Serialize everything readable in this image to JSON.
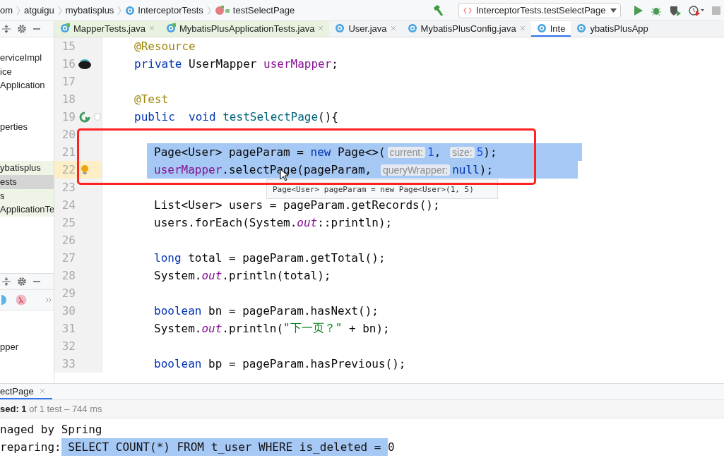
{
  "breadcrumbs": [
    {
      "label": "om",
      "kind": "package"
    },
    {
      "label": "atguigu",
      "kind": "package"
    },
    {
      "label": "mybatisplus",
      "kind": "package"
    },
    {
      "label": "InterceptorTests",
      "kind": "class"
    },
    {
      "label": "testSelectPage",
      "kind": "method"
    }
  ],
  "run_config": {
    "label": "InterceptorTests.testSelectPage"
  },
  "editor_tabs": [
    {
      "label": "MapperTests.java",
      "kind": "test",
      "selected": false
    },
    {
      "label": "MybatisPlusApplicationTests.java",
      "kind": "test",
      "selected": false
    },
    {
      "label": "User.java",
      "kind": "source",
      "selected": false
    },
    {
      "label": "MybatisPlusConfig.java",
      "kind": "source",
      "selected": false
    },
    {
      "label": "Inte",
      "kind": "source",
      "selected": true
    },
    {
      "label": "ybatisPlusApp",
      "kind": "source",
      "selected": false
    }
  ],
  "project_tree": [
    {
      "label": "erviceImpl",
      "kind": "source",
      "selected": false
    },
    {
      "label": "ice",
      "kind": "source",
      "selected": false
    },
    {
      "label": "Application",
      "kind": "source",
      "selected": false
    },
    {
      "label": "perties",
      "kind": "source",
      "selected": false
    },
    {
      "label": "ybatisplus",
      "kind": "test",
      "selected": false
    },
    {
      "label": "ests",
      "kind": "test",
      "selected": true
    },
    {
      "label": "s",
      "kind": "test",
      "selected": false
    },
    {
      "label": "ApplicationTe",
      "kind": "test",
      "selected": false
    }
  ],
  "structure_panel": {
    "items": [
      {
        "label": "pper"
      }
    ]
  },
  "code_lines": [
    {
      "number": "15",
      "kind": "plain",
      "selected": false,
      "current": false,
      "segments": [
        {
          "kind": "annotation",
          "text": "@Resource"
        }
      ]
    },
    {
      "number": "16",
      "kind": "bean",
      "selected": false,
      "current": false,
      "segments": [
        {
          "kind": "keyword",
          "text": "private"
        },
        {
          "kind": "plain",
          "text": " UserMapper "
        },
        {
          "kind": "field",
          "text": "userMapper"
        },
        {
          "kind": "plain",
          "text": ";"
        }
      ]
    },
    {
      "number": "17",
      "kind": "plain",
      "selected": false,
      "current": false
    },
    {
      "number": "18",
      "kind": "plain",
      "selected": false,
      "current": false,
      "segments": [
        {
          "kind": "annotation",
          "text": "@Test"
        }
      ]
    },
    {
      "number": "19",
      "kind": "run",
      "selected": false,
      "current": false,
      "segments": [
        {
          "kind": "keyword",
          "text": "public"
        },
        {
          "kind": "keyword",
          "text": "  void"
        },
        {
          "kind": "method",
          "text": " testSelectPage"
        },
        {
          "kind": "plain",
          "text": "(){"
        }
      ],
      "children": [
        {
          "number": "20",
          "kind": "plain",
          "selected": false,
          "current": false
        },
        {
          "number": "21",
          "kind": "plain",
          "selected": true,
          "current": false,
          "segments": [
            {
              "kind": "plain",
              "text": "Page<User> pageParam = "
            },
            {
              "kind": "keyword",
              "text": "new"
            },
            {
              "kind": "plain",
              "text": " Page<>("
            },
            {
              "kind": "hint",
              "text": "current:"
            },
            {
              "kind": "number",
              "text": "1"
            },
            {
              "kind": "plain",
              "text": ", "
            },
            {
              "kind": "hint",
              "text": "size:"
            },
            {
              "kind": "number",
              "text": "5"
            },
            {
              "kind": "plain",
              "text": ");"
            }
          ]
        },
        {
          "number": "22",
          "kind": "bulb",
          "selected": true,
          "current": true,
          "segments": [
            {
              "kind": "field",
              "text": "userMapper"
            },
            {
              "kind": "plain",
              "text": ".selectPage(pageParam, "
            },
            {
              "kind": "hint",
              "text": "queryWrapper:"
            },
            {
              "kind": "keyword",
              "text": "null"
            },
            {
              "kind": "plain",
              "text": ");"
            }
          ]
        },
        {
          "number": "23",
          "kind": "plain",
          "selected": false,
          "current": false
        },
        {
          "number": "24",
          "kind": "plain",
          "selected": false,
          "current": false,
          "segments": [
            {
              "kind": "plain",
              "text": "List<User> users = pageParam.getRecords();"
            }
          ]
        },
        {
          "number": "25",
          "kind": "plain",
          "selected": false,
          "current": false,
          "segments": [
            {
              "kind": "plain",
              "text": "users.forEach(System."
            },
            {
              "kind": "static",
              "text": "out"
            },
            {
              "kind": "plain",
              "text": "::println);"
            }
          ]
        },
        {
          "number": "26",
          "kind": "plain",
          "selected": false,
          "current": false
        },
        {
          "number": "27",
          "kind": "plain",
          "selected": false,
          "current": false,
          "segments": [
            {
              "kind": "keyword",
              "text": "long"
            },
            {
              "kind": "plain",
              "text": " total = pageParam.getTotal();"
            }
          ]
        },
        {
          "number": "28",
          "kind": "plain",
          "selected": false,
          "current": false,
          "segments": [
            {
              "kind": "plain",
              "text": "System."
            },
            {
              "kind": "static",
              "text": "out"
            },
            {
              "kind": "plain",
              "text": ".println(total);"
            }
          ]
        },
        {
          "number": "29",
          "kind": "plain",
          "selected": false,
          "current": false
        },
        {
          "number": "30",
          "kind": "plain",
          "selected": false,
          "current": false,
          "segments": [
            {
              "kind": "keyword",
              "text": "boolean"
            },
            {
              "kind": "plain",
              "text": " bn = pageParam.hasNext();"
            }
          ]
        },
        {
          "number": "31",
          "kind": "plain",
          "selected": false,
          "current": false,
          "segments": [
            {
              "kind": "plain",
              "text": "System."
            },
            {
              "kind": "static",
              "text": "out"
            },
            {
              "kind": "plain",
              "text": ".println("
            },
            {
              "kind": "string",
              "text": "\"下一页？\""
            },
            {
              "kind": "plain",
              "text": " + bn);"
            }
          ]
        },
        {
          "number": "32",
          "kind": "plain",
          "selected": false,
          "current": false
        },
        {
          "number": "33",
          "kind": "plain",
          "selected": false,
          "current": false,
          "segments": [
            {
              "kind": "keyword",
              "text": "boolean"
            },
            {
              "kind": "plain",
              "text": " bp = pageParam.hasPrevious();"
            }
          ]
        }
      ]
    }
  ],
  "quick_doc_popup": {
    "text": "Page<User> pageParam = new Page<User>(1, 5)"
  },
  "run_panel": {
    "tab": {
      "label": "ectPage",
      "selected": true
    },
    "status": "**sed: 1** of 1 test – 744 ms",
    "console_lines": [
      {
        "segments": [
          {
            "text": "naged by Spring",
            "selected": false
          }
        ]
      },
      {
        "segments": [
          {
            "text": "reparing:",
            "selected": false
          },
          {
            "text": " SELECT COUNT(*) FROM t_user WHERE is_deleted = ",
            "selected": true
          },
          {
            "text": "0",
            "selected": false
          }
        ]
      }
    ]
  }
}
